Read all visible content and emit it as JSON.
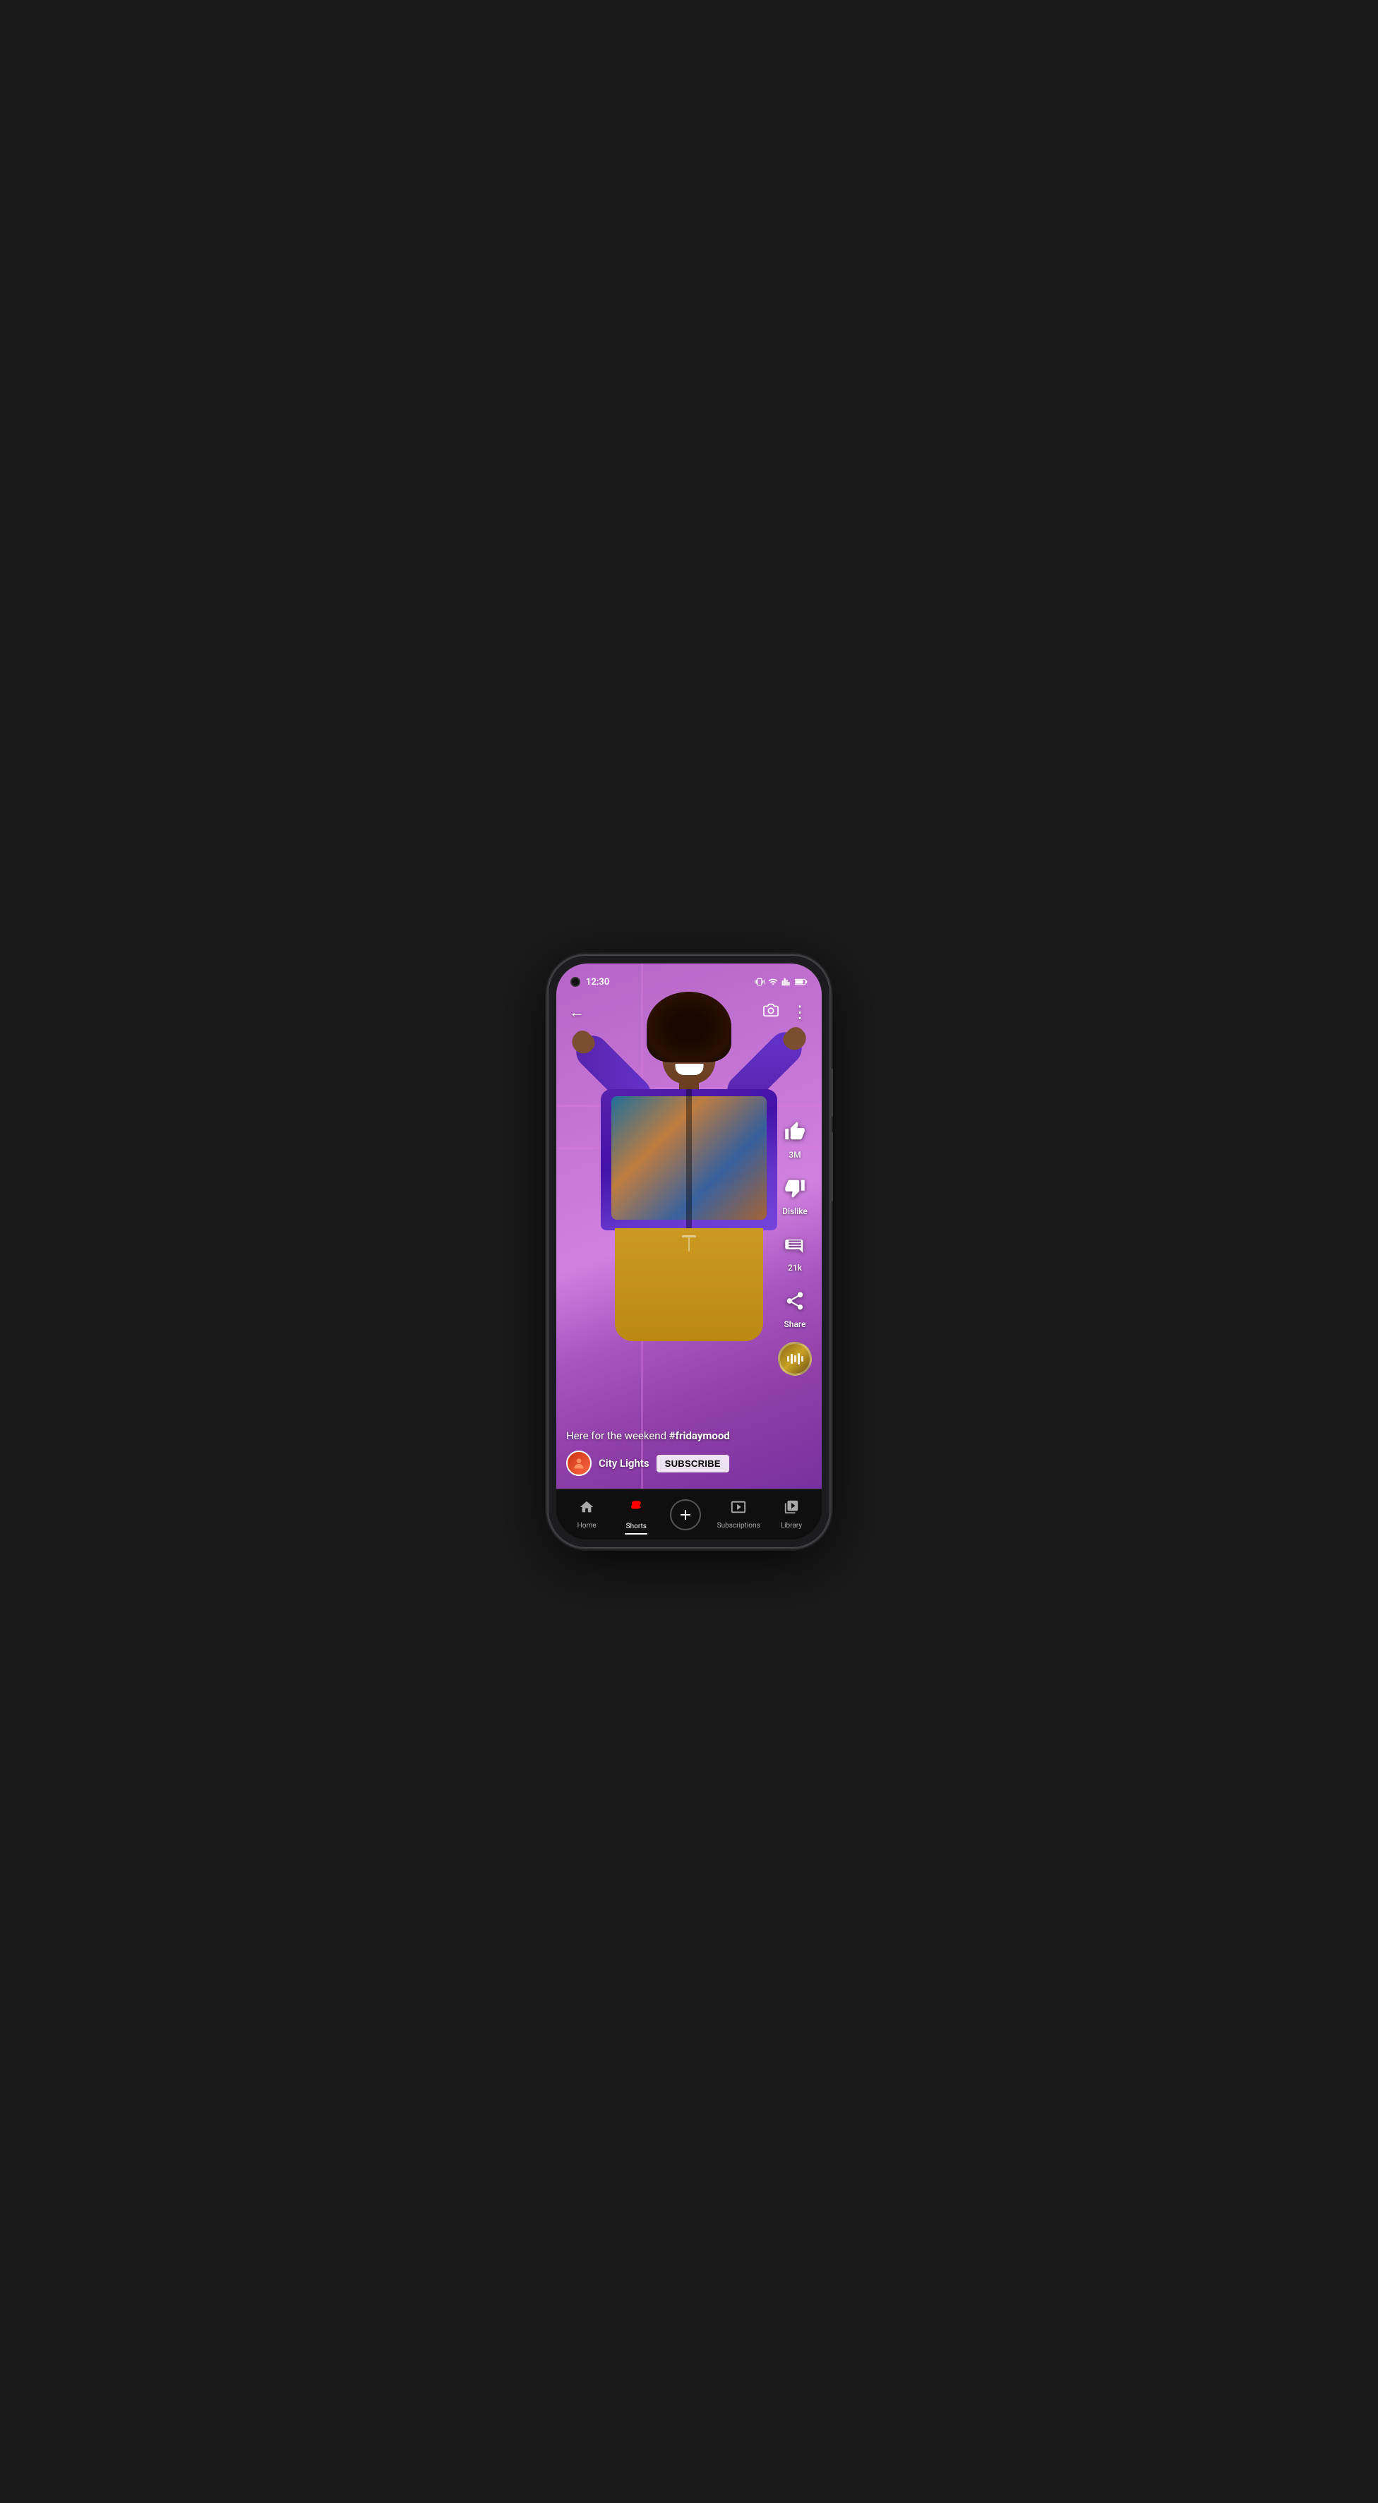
{
  "device": {
    "time": "12:30"
  },
  "top_nav": {
    "back_label": "←",
    "camera_label": "📷",
    "more_label": "⋮"
  },
  "video": {
    "caption_text": "Here for the weekend ",
    "caption_hashtag": "#fridaymood",
    "channel_name": "City Lights",
    "subscribe_label": "SUBSCRIBE"
  },
  "actions": {
    "like_count": "3M",
    "dislike_label": "Dislike",
    "comment_count": "21k",
    "share_label": "Share"
  },
  "bottom_nav": {
    "items": [
      {
        "id": "home",
        "label": "Home",
        "icon": "🏠",
        "active": false
      },
      {
        "id": "shorts",
        "label": "Shorts",
        "icon": "⚡",
        "active": true
      },
      {
        "id": "create",
        "label": "",
        "icon": "+",
        "active": false
      },
      {
        "id": "subscriptions",
        "label": "Subscriptions",
        "icon": "▶",
        "active": false
      },
      {
        "id": "library",
        "label": "Library",
        "icon": "📚",
        "active": false
      }
    ]
  },
  "colors": {
    "background_purple": "#c070d0",
    "jacket_purple": "#5522bb",
    "pants_yellow": "#cc9922",
    "accent_red": "#ff0000",
    "nav_bg": "#0f0f0f"
  }
}
